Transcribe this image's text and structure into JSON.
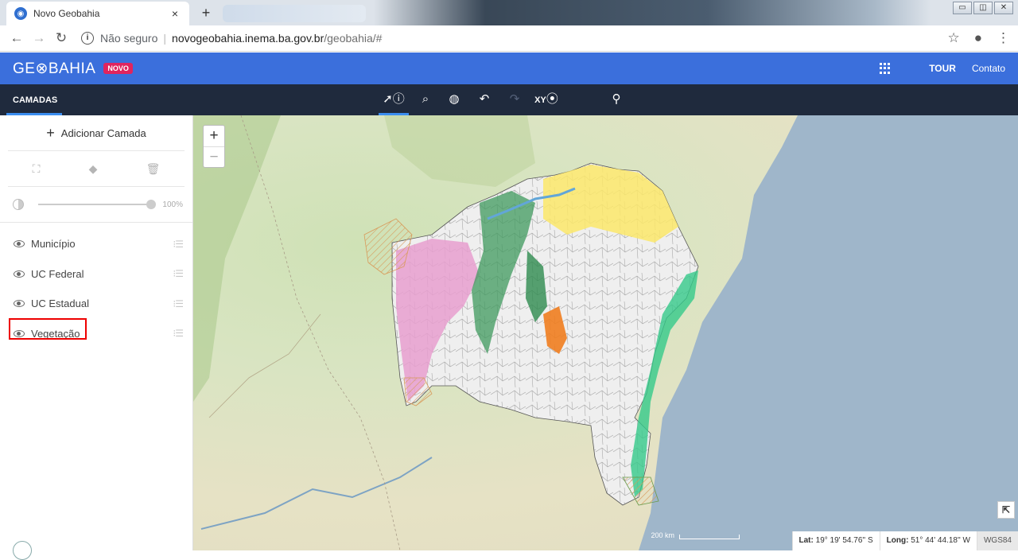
{
  "browser": {
    "tab_title": "Novo Geobahia",
    "tab_close": "×",
    "new_tab": "+",
    "security": "Não seguro",
    "url_domain": "novogeobahia.inema.ba.gov.br",
    "url_path": "/geobahia/#"
  },
  "header": {
    "logo": "GE⊗BAHIA",
    "badge": "NOVO",
    "tour": "TOUR",
    "contact": "Contato"
  },
  "toolbar": {
    "layers_tab": "CAMADAS",
    "coord_tool": "XY"
  },
  "sidebar": {
    "add_layer": "Adicionar Camada",
    "opacity_value": "100%",
    "opacity_fraction": 1.0,
    "layers": [
      {
        "label": "Município"
      },
      {
        "label": "UC Federal"
      },
      {
        "label": "UC Estadual"
      },
      {
        "label": "Vegetação"
      }
    ]
  },
  "map": {
    "zoom_in": "+",
    "zoom_out": "−",
    "scale": "200 km",
    "lat_label": "Lat:",
    "lat_value": "19° 19' 54.76'' S",
    "long_label": "Long:",
    "long_value": "51° 44' 44.18'' W",
    "crs": "WGS84"
  },
  "colors": {
    "appbar": "#3b6fdc",
    "toolbar": "#1f2a3d",
    "accent": "#3b8ef0",
    "badge": "#e0245e",
    "ocean": "#9fb6ca"
  }
}
